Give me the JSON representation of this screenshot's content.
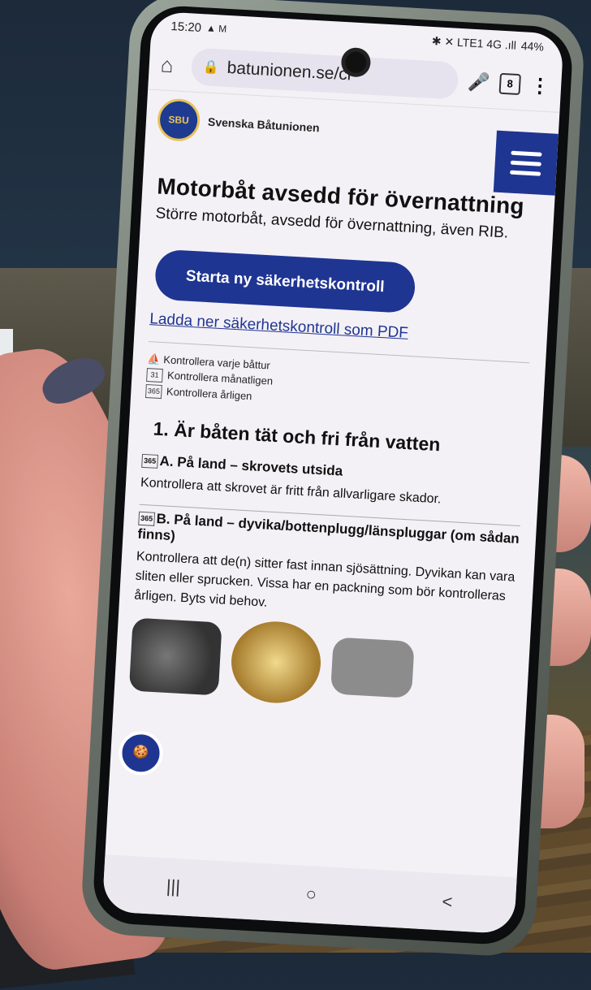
{
  "status": {
    "time": "15:20",
    "left_icons": "▲ M",
    "right_icons": "✱ ✕ LTE1 4G .ıll",
    "battery": "44%"
  },
  "browser": {
    "url": "batunionen.se/cl",
    "tab_count": "8"
  },
  "site": {
    "logo_text": "SBU",
    "name": "Svenska Båtunionen"
  },
  "page": {
    "title": "Motorbåt avsedd för övernattning",
    "lead": "Större motorbåt, avsedd för övernattning, även RIB.",
    "start_button": "Starta ny säkerhetskontroll",
    "pdf_link": "Ladda ner säkerhetskontroll som PDF",
    "legend": [
      {
        "icon": "⛵",
        "text": "Kontrollera varje båttur"
      },
      {
        "icon": "31",
        "text": "Kontrollera månatligen"
      },
      {
        "icon": "365",
        "text": "Kontrollera årligen"
      }
    ],
    "section_title": "1. Är båten tät och fri från vatten",
    "items": [
      {
        "badge": "365",
        "title": "A. På land – skrovets utsida",
        "text": "Kontrollera att skrovet är fritt från allvarligare skador."
      },
      {
        "badge": "365",
        "title": "B. På land – dyvika/bottenplugg/länspluggar (om sådan finns)",
        "text": "Kontrollera att de(n) sitter fast innan sjösättning. Dyvikan kan vara sliten eller sprucken. Vissa har en packning som bör kontrolleras årligen. Byts vid behov."
      }
    ]
  },
  "navbar": {
    "recents": "|||",
    "home": "○",
    "back": "<"
  },
  "colors": {
    "brand": "#1f3592",
    "gold": "#e8c35a"
  }
}
